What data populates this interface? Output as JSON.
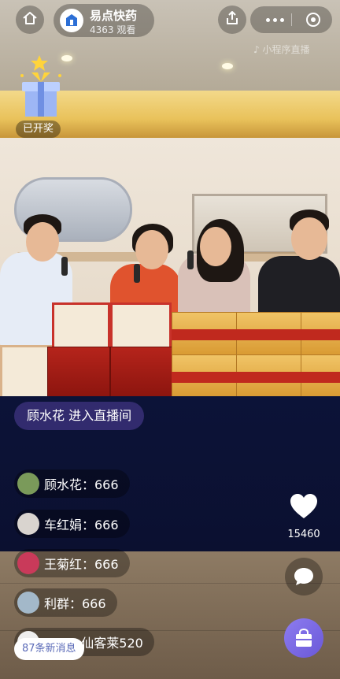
{
  "header": {
    "host_name": "易点快药",
    "viewer_count": "4363 观看",
    "avatar_logo_text": "易点快药"
  },
  "icons": {
    "home": "home-icon",
    "share": "share-icon",
    "more": "more-dots-icon",
    "close": "target-icon",
    "gift": "gift-box-icon",
    "like": "heart-icon",
    "comment": "chat-bubble-icon",
    "shop": "shopping-bag-icon"
  },
  "watermark": "小程序直播",
  "lottery": {
    "status": "已开奖"
  },
  "entry_banner": "顾水花 进入直播间",
  "comments": [
    {
      "text": "顾水花：666",
      "avatar_color": "#7a9a5a"
    },
    {
      "text": "车红娟：666",
      "avatar_color": "#d9d4cf"
    },
    {
      "text": "王菊红：666",
      "avatar_color": "#c93a5a"
    },
    {
      "text": "利群：666",
      "avatar_color": "#a3b8c9"
    },
    {
      "text": "1… ：仙客莱520",
      "avatar_color": "#eeeeee"
    }
  ],
  "new_messages": "87条新消息",
  "likes": {
    "count": "15460"
  },
  "colors": {
    "accent": "#6a58d8",
    "banner": "#3a3078"
  }
}
